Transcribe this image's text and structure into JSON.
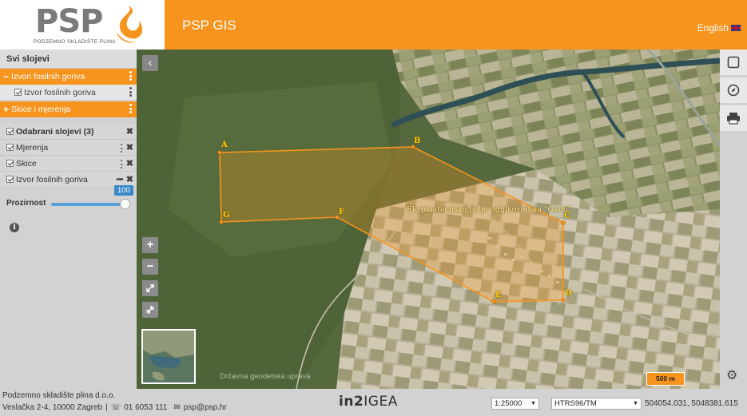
{
  "header": {
    "logo_text": "PSP",
    "logo_subtitle": "PODZEMNO SKLADIŠTE PLINA",
    "app_title": "PSP GIS",
    "language_label": "English"
  },
  "sidebar": {
    "title": "Svi slojevi",
    "groups": [
      {
        "sign": "−",
        "label": "Izvori fosilnih goriva",
        "expanded": true,
        "children": [
          {
            "label": "Izvor fosilnih goriva",
            "checked": true
          }
        ]
      },
      {
        "sign": "+",
        "label": "Skice i mjerenja",
        "expanded": false
      }
    ],
    "selected_title": "Odabrani slojevi (3)",
    "selected_layers": [
      {
        "label": "Mjerenja"
      },
      {
        "label": "Skice"
      },
      {
        "label": "Izvor fosilnih goriva"
      }
    ],
    "opacity_label": "Prozirnost",
    "opacity_value": "100",
    "opacity_level": 1.0
  },
  "map": {
    "polygon_label": "Eksploatacijsko polje ugljikovodika \"Okoli\"",
    "vertex_labels": [
      "A",
      "B",
      "C",
      "D",
      "E",
      "F",
      "G"
    ],
    "watermark": "Državna geodetska uprava",
    "scale_label": "500 m",
    "collapse_icon": "chevron-left-icon",
    "zoom_in": "+",
    "zoom_out": "−",
    "accent_color": "#f7941d"
  },
  "toolbar": {
    "items": [
      "square-icon",
      "compass-icon",
      "print-icon"
    ],
    "settings": "gear-icon"
  },
  "footer": {
    "company": "Podzemno skladište plina d.o.o.",
    "address": "Veslačka 2-4, 10000 Zagreb",
    "separator": "|",
    "phone": "01 6053 111",
    "email": "psp@psp.hr",
    "brand_a": "in2",
    "brand_b": "IGEA",
    "scale_select": "1:25000",
    "crs_select": "HTRS96/TM",
    "coordinates": "504054.031, 5048381.615"
  }
}
